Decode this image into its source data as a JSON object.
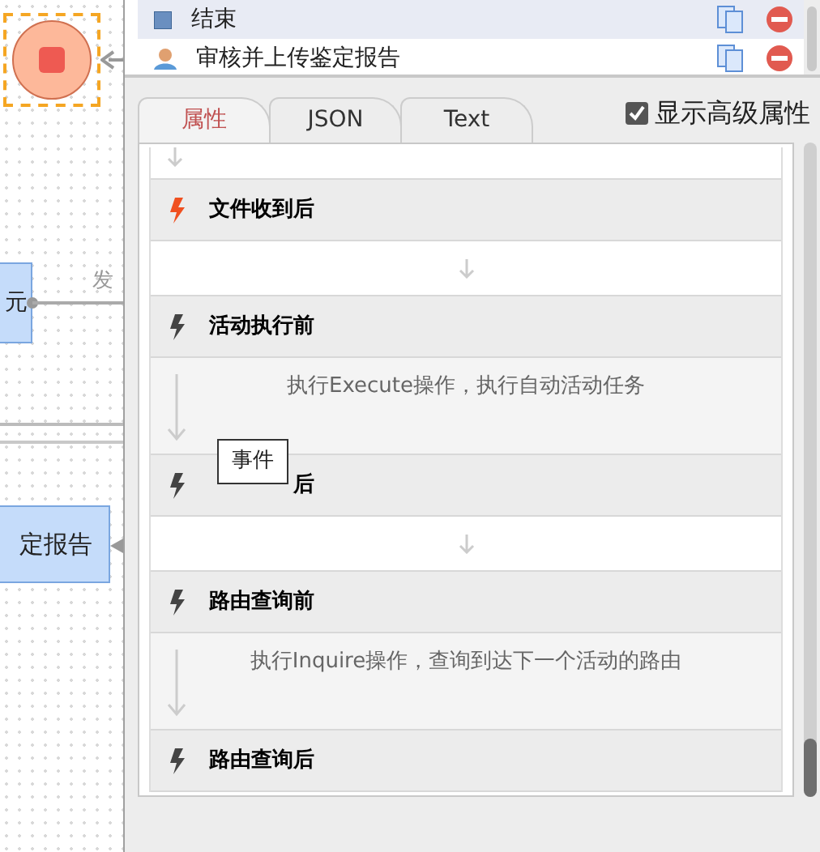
{
  "canvas": {
    "node_label_top": "元",
    "edge_label": "发",
    "node_label_bottom": "定报告"
  },
  "activities": [
    {
      "label": "结束",
      "kind": "end",
      "selected": true
    },
    {
      "label": "审核并上传鉴定报告",
      "kind": "person",
      "selected": false
    }
  ],
  "tabs": [
    {
      "label": "属性",
      "selected": true
    },
    {
      "label": "JSON",
      "selected": false
    },
    {
      "label": "Text",
      "selected": false
    }
  ],
  "show_advanced": {
    "label": "显示高级属性",
    "checked": true
  },
  "rows": [
    {
      "kind": "step"
    },
    {
      "kind": "event",
      "label": "文件收到后",
      "highlighted": true
    },
    {
      "kind": "step"
    },
    {
      "kind": "event",
      "label": "活动执行前",
      "highlighted": false
    },
    {
      "kind": "step",
      "description": "执行Execute操作，执行自动活动任务"
    },
    {
      "kind": "event",
      "label": "后",
      "highlighted": false,
      "partly_hidden": true
    },
    {
      "kind": "step"
    },
    {
      "kind": "event",
      "label": "路由查询前",
      "highlighted": false
    },
    {
      "kind": "step",
      "description": "执行Inquire操作，查询到达下一个活动的路由"
    },
    {
      "kind": "event",
      "label": "路由查询后",
      "highlighted": false
    }
  ],
  "tooltip": "事件"
}
